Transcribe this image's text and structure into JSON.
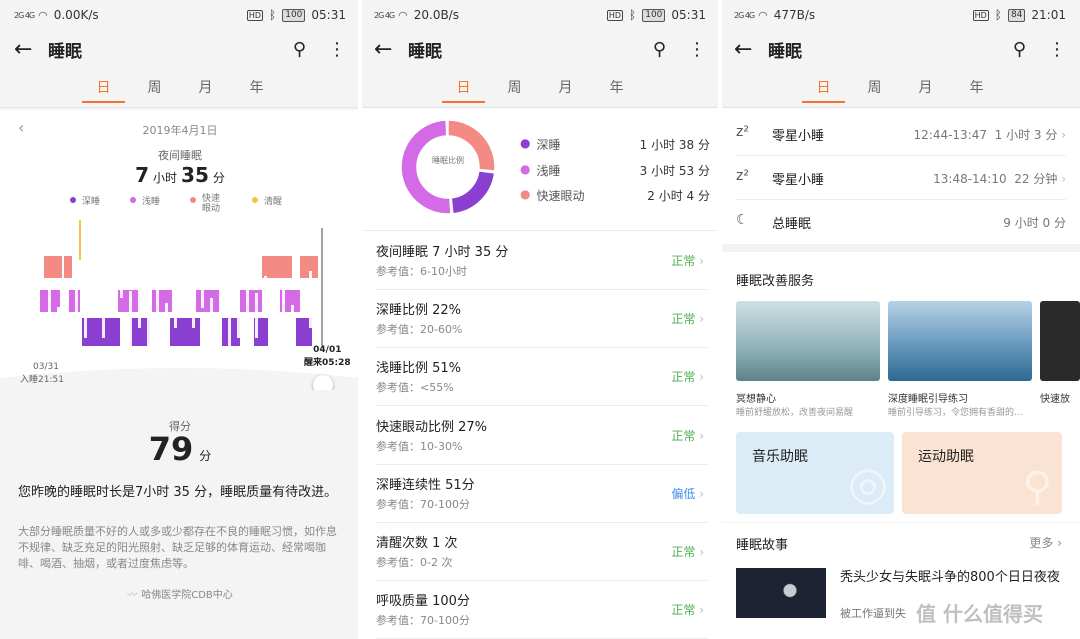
{
  "panels": [
    {
      "status": {
        "signal": "2G 4G",
        "speed": "0.00K/s",
        "hd": "HD",
        "battery": "100",
        "time": "05:31"
      },
      "title": "睡眠",
      "tabs": [
        "日",
        "周",
        "月",
        "年"
      ],
      "date": "2019年4月1日",
      "night_label": "夜间睡眠",
      "duration": {
        "h": "7",
        "hu": "小时",
        "m": "35",
        "mu": "分"
      },
      "legend": [
        "深睡",
        "浅睡",
        "快速眼动",
        "清醒"
      ],
      "start": {
        "date": "03/31",
        "text": "入睡21:51"
      },
      "end": {
        "date": "04/01",
        "text": "醒来05:28"
      },
      "score_label": "得分",
      "score": "79",
      "score_unit": "分",
      "summary": "您昨晚的睡眠时长是7小时 35 分，睡眠质量有待改进。",
      "advice": "大部分睡眠质量不好的人或多或少都存在不良的睡眠习惯，如作息不规律、缺乏充足的阳光照射、缺乏足够的体育运动、经常喝咖啡、喝酒、抽烟，或者过度焦虑等。",
      "source": "哈佛医学院CDB中心"
    },
    {
      "status": {
        "signal": "2G 4G",
        "speed": "20.0B/s",
        "hd": "HD",
        "battery": "100",
        "time": "05:31"
      },
      "title": "睡眠",
      "tabs": [
        "日",
        "周",
        "月",
        "年"
      ],
      "donut_label": "睡眠比例",
      "stages": [
        {
          "name": "深睡",
          "value": "1 小时 38 分",
          "pct": 22
        },
        {
          "name": "浅睡",
          "value": "3 小时 53 分",
          "pct": 51
        },
        {
          "name": "快速眼动",
          "value": "2 小时 4 分",
          "pct": 27
        }
      ],
      "metrics": [
        {
          "title": "夜间睡眠  7 小时 35 分",
          "ref": "参考值：6-10小时",
          "status": "正常"
        },
        {
          "title": "深睡比例  22%",
          "ref": "参考值：20-60%",
          "status": "正常"
        },
        {
          "title": "浅睡比例  51%",
          "ref": "参考值：<55%",
          "status": "正常"
        },
        {
          "title": "快速眼动比例  27%",
          "ref": "参考值：10-30%",
          "status": "正常"
        },
        {
          "title": "深睡连续性  51分",
          "ref": "参考值：70-100分",
          "status": "偏低"
        },
        {
          "title": "清醒次数  1 次",
          "ref": "参考值：0-2 次",
          "status": "正常"
        },
        {
          "title": "呼吸质量  100分",
          "ref": "参考值：70-100分",
          "status": "正常"
        }
      ]
    },
    {
      "status": {
        "signal": "2G 4G",
        "speed": "477B/s",
        "hd": "HD",
        "battery": "84",
        "time": "21:01"
      },
      "title": "睡眠",
      "tabs": [
        "日",
        "周",
        "月",
        "年"
      ],
      "naps": [
        {
          "name": "零星小睡",
          "time": "12:44-13:47",
          "dur": "1 小时 3 分"
        },
        {
          "name": "零星小睡",
          "time": "13:48-14:10",
          "dur": "22 分钟"
        },
        {
          "name": "总睡眠",
          "time": "",
          "dur": "9 小时 0 分"
        }
      ],
      "service_title": "睡眠改善服务",
      "services": [
        {
          "title": "冥想静心",
          "desc": "睡前舒缓放松，改善夜间易醒"
        },
        {
          "title": "深度睡眠引导练习",
          "desc": "睡前引导练习，令您拥有香甜的..."
        },
        {
          "title": "快速放",
          "desc": ""
        }
      ],
      "cards": [
        "音乐助眠",
        "运动助眠"
      ],
      "story_title": "睡眠故事",
      "more": "更多",
      "story": {
        "title": "秃头少女与失眠斗争的800个日日夜夜",
        "desc": "被工作逼到失"
      },
      "watermark": "值 什么值得买"
    }
  ],
  "colors": {
    "accent": "#f2732e",
    "deep": "#8a3fd1",
    "light": "#d46ae6",
    "rem": "#f48a84",
    "awake": "#f5c242",
    "normal": "#4caf50",
    "low": "#3d8be8"
  }
}
